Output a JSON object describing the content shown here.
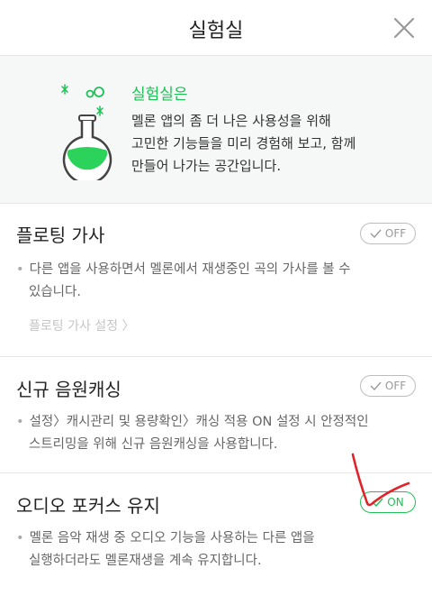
{
  "header": {
    "title": "실험실",
    "close_icon": "close-icon"
  },
  "intro": {
    "title": "실험실은",
    "lines": [
      "멜론 앱의 좀 더 나은 사용성을 위해",
      "고민한 기능들을 미리 경험해 보고, 함께",
      "만들어 나가는 공간입니다."
    ],
    "icon": "flask-icon",
    "accent": "#1fc156"
  },
  "sections": [
    {
      "title": "플로팅 가사",
      "toggle": "OFF",
      "desc_lines": [
        "다른 앱을 사용하면서 멜론에서 재생중인 곡의 가사를 볼 수",
        "있습니다."
      ],
      "link": "플로팅 가사 설정"
    },
    {
      "title": "신규 음원캐싱",
      "toggle": "OFF",
      "desc_lines": [
        "설정〉캐시관리 및 용량확인〉캐싱 적용 ON 설정 시 안정적인",
        "스트리밍을 위해 신규 음원캐싱을 사용합니다."
      ]
    },
    {
      "title": "오디오 포커스 유지",
      "toggle": "ON",
      "desc_lines": [
        "멜론 음악 재생 중 오디오 기능을 사용하는 다른 앱을",
        "실행하더라도 멜론재생을 계속 유지합니다."
      ]
    }
  ],
  "colors": {
    "green": "#1fc156",
    "annotation_red": "#e0242b"
  }
}
